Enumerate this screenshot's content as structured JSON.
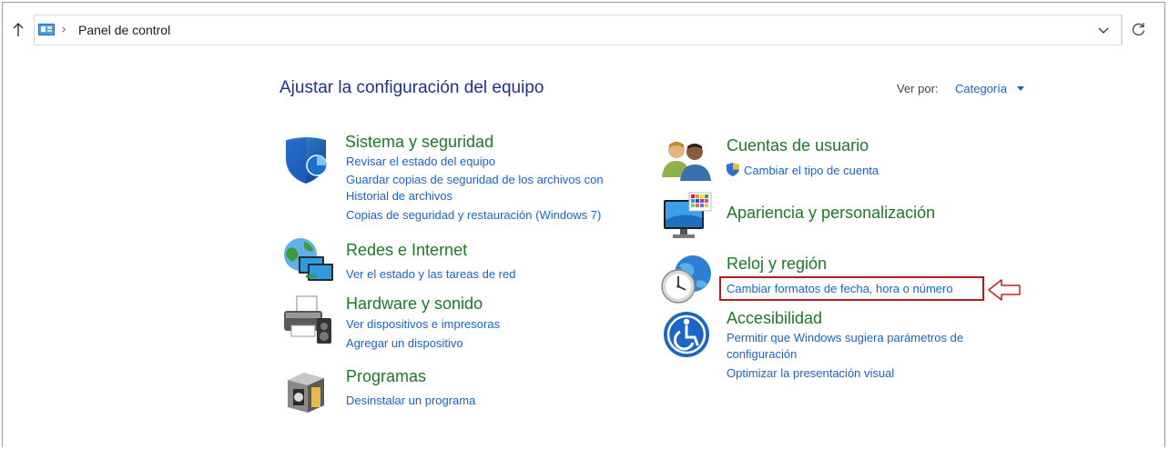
{
  "address_bar": {
    "path": "Panel de control"
  },
  "header": {
    "title": "Ajustar la configuración del equipo",
    "view_by_label": "Ver por:",
    "view_by_value": "Categoría"
  },
  "categories": {
    "system": {
      "title": "Sistema y seguridad",
      "icon": "shield-icon",
      "links": [
        "Revisar el estado del equipo",
        "Guardar copias de seguridad de los archivos con",
        "Historial de archivos",
        "Copias de seguridad y restauración (Windows 7)"
      ]
    },
    "network": {
      "title": "Redes e Internet",
      "icon": "network-globe-icon",
      "links": [
        "Ver el estado y las tareas de red"
      ]
    },
    "hardware": {
      "title": "Hardware y sonido",
      "icon": "printer-icon",
      "links": [
        "Ver dispositivos e impresoras",
        "Agregar un dispositivo"
      ]
    },
    "programs": {
      "title": "Programas",
      "icon": "programs-box-icon",
      "links": [
        "Desinstalar un programa"
      ]
    },
    "users": {
      "title": "Cuentas de usuario",
      "icon": "users-icon",
      "links": [
        "Cambiar el tipo de cuenta"
      ]
    },
    "appearance": {
      "title": "Apariencia y personalización",
      "icon": "monitor-palette-icon",
      "links": []
    },
    "clock": {
      "title": "Reloj y región",
      "icon": "clock-globe-icon",
      "links": [
        "Cambiar formatos de fecha, hora o número"
      ]
    },
    "accessibility": {
      "title": "Accesibilidad",
      "icon": "accessibility-icon",
      "links": [
        "Permitir que Windows sugiera parámetros de",
        "configuración",
        "Optimizar la presentación visual"
      ]
    }
  },
  "colors": {
    "category_title": "#1b7a26",
    "link": "#1a64c8",
    "page_title": "#1e3287",
    "highlight": "#b01e1e"
  }
}
